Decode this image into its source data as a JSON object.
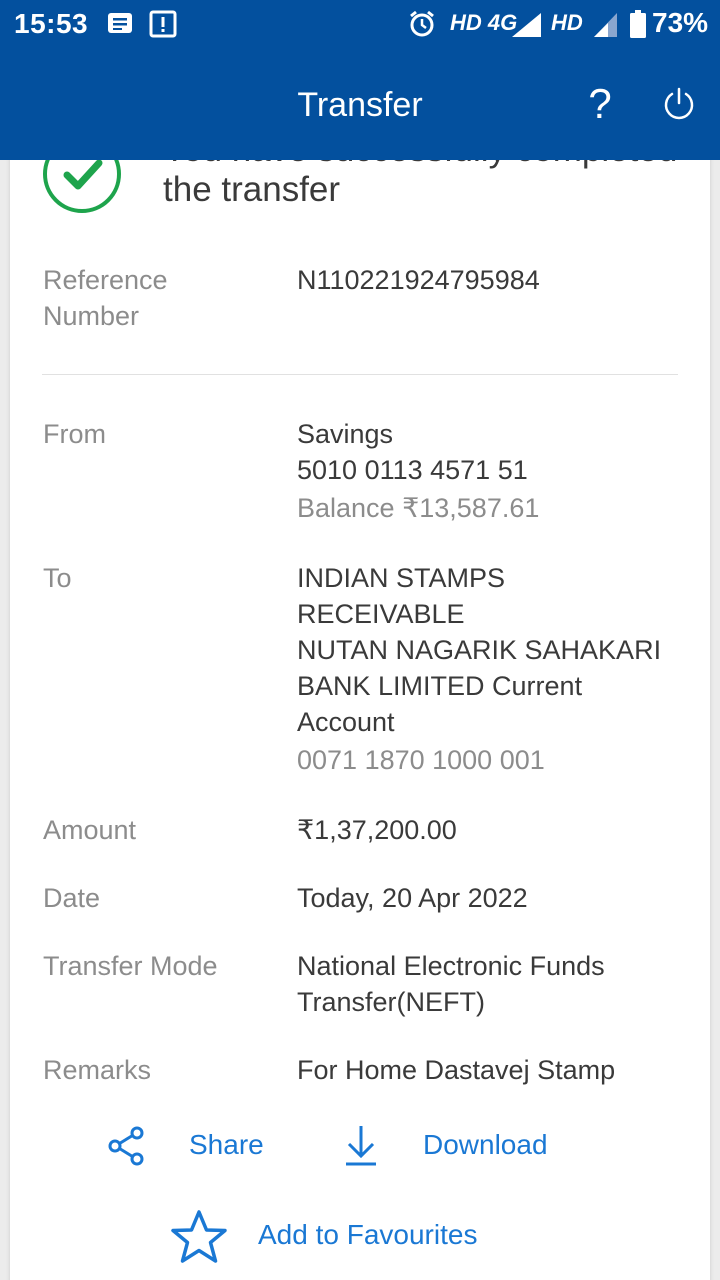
{
  "status_bar": {
    "time": "15:53",
    "network_1": "HD 4G",
    "network_2": "HD",
    "battery": "73%"
  },
  "toolbar": {
    "title": "Transfer",
    "help_label": "?"
  },
  "confirmation": {
    "message": "You have successfully completed the transfer"
  },
  "details": {
    "reference": {
      "label": "Reference Number",
      "value": "N110221924795984"
    },
    "from": {
      "label": "From",
      "account_type": "Savings",
      "account_number": "5010 0113 4571 51",
      "balance": "Balance ₹13,587.61"
    },
    "to": {
      "label": "To",
      "line1": "INDIAN STAMPS",
      "line2": "RECEIVABLE",
      "line3": "NUTAN NAGARIK SAHAKARI",
      "line4": "BANK LIMITED Current",
      "line5": "Account",
      "account_number": "0071 1870 1000 001"
    },
    "amount": {
      "label": "Amount",
      "value": "₹1,37,200.00"
    },
    "date": {
      "label": "Date",
      "value": "Today, 20 Apr 2022"
    },
    "mode": {
      "label": "Transfer Mode",
      "line1": "National Electronic Funds",
      "line2": "Transfer(NEFT)"
    },
    "remarks": {
      "label": "Remarks",
      "value": "For Home Dastavej Stamp"
    }
  },
  "actions": {
    "share": "Share",
    "download": "Download",
    "favourites": "Add to Favourites"
  },
  "colors": {
    "primary": "#03509e",
    "success": "#1ea44c",
    "link": "#1a78d4"
  }
}
